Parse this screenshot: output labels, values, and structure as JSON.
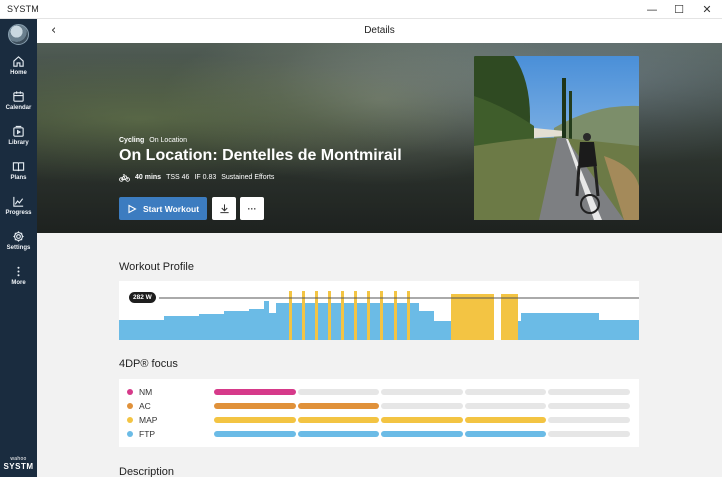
{
  "window": {
    "title": "SYSTM",
    "controls": [
      "—",
      "☐",
      "✕"
    ]
  },
  "sidebar": {
    "items": [
      {
        "label": "Home",
        "icon": "home-icon"
      },
      {
        "label": "Calendar",
        "icon": "calendar-icon"
      },
      {
        "label": "Library",
        "icon": "library-icon"
      },
      {
        "label": "Plans",
        "icon": "plans-icon"
      },
      {
        "label": "Progress",
        "icon": "progress-icon"
      },
      {
        "label": "Settings",
        "icon": "gear-icon"
      },
      {
        "label": "More",
        "icon": "more-vertical-icon"
      }
    ],
    "brand_top": "wahoo",
    "brand_main": "SYSTM"
  },
  "header": {
    "back": "‹",
    "title": "Details"
  },
  "hero": {
    "category": "Cycling",
    "subcategory": "On Location",
    "title": "On Location: Dentelles de Montmirail",
    "duration": "40 mins",
    "tss": "TSS 46",
    "if": "IF 0.83",
    "focus": "Sustained Efforts",
    "start_label": "Start Workout",
    "more_label": "···"
  },
  "profile": {
    "title": "Workout Profile",
    "ftp_label": "282 W",
    "colors": {
      "base": "#6bbbe6",
      "interval": "#f3c443",
      "ftp_line": "#555555"
    }
  },
  "focus": {
    "title": "4DP® focus",
    "rows": [
      {
        "name": "NM",
        "color": "#d63a8a",
        "filled": 1
      },
      {
        "name": "AC",
        "color": "#e0913a",
        "filled": 2
      },
      {
        "name": "MAP",
        "color": "#f3c443",
        "filled": 4
      },
      {
        "name": "FTP",
        "color": "#6bbbe6",
        "filled": 4
      }
    ],
    "segments": 5,
    "empty_color": "#e6e6e6"
  },
  "description": {
    "title": "Description"
  }
}
